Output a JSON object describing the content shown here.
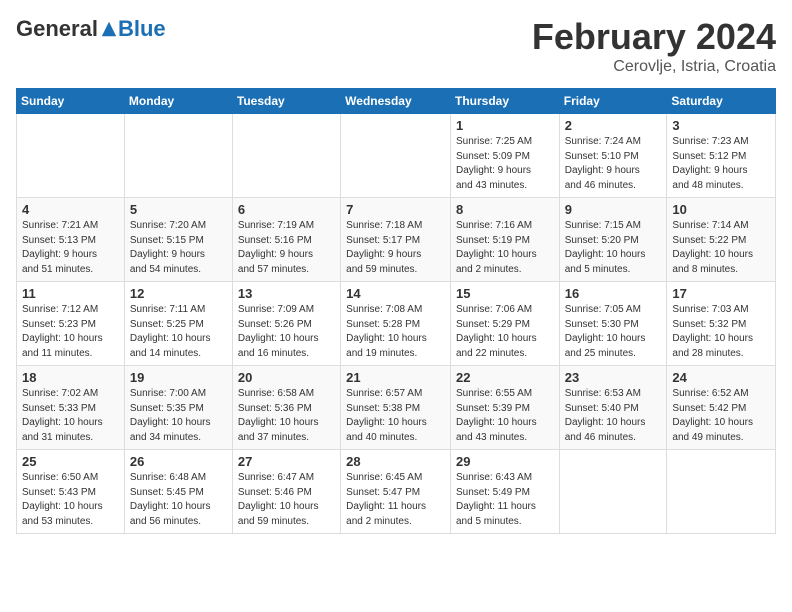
{
  "logo": {
    "general": "General",
    "blue": "Blue"
  },
  "header": {
    "month": "February 2024",
    "location": "Cerovlje, Istria, Croatia"
  },
  "days_of_week": [
    "Sunday",
    "Monday",
    "Tuesday",
    "Wednesday",
    "Thursday",
    "Friday",
    "Saturday"
  ],
  "weeks": [
    [
      {
        "day": "",
        "info": ""
      },
      {
        "day": "",
        "info": ""
      },
      {
        "day": "",
        "info": ""
      },
      {
        "day": "",
        "info": ""
      },
      {
        "day": "1",
        "info": "Sunrise: 7:25 AM\nSunset: 5:09 PM\nDaylight: 9 hours\nand 43 minutes."
      },
      {
        "day": "2",
        "info": "Sunrise: 7:24 AM\nSunset: 5:10 PM\nDaylight: 9 hours\nand 46 minutes."
      },
      {
        "day": "3",
        "info": "Sunrise: 7:23 AM\nSunset: 5:12 PM\nDaylight: 9 hours\nand 48 minutes."
      }
    ],
    [
      {
        "day": "4",
        "info": "Sunrise: 7:21 AM\nSunset: 5:13 PM\nDaylight: 9 hours\nand 51 minutes."
      },
      {
        "day": "5",
        "info": "Sunrise: 7:20 AM\nSunset: 5:15 PM\nDaylight: 9 hours\nand 54 minutes."
      },
      {
        "day": "6",
        "info": "Sunrise: 7:19 AM\nSunset: 5:16 PM\nDaylight: 9 hours\nand 57 minutes."
      },
      {
        "day": "7",
        "info": "Sunrise: 7:18 AM\nSunset: 5:17 PM\nDaylight: 9 hours\nand 59 minutes."
      },
      {
        "day": "8",
        "info": "Sunrise: 7:16 AM\nSunset: 5:19 PM\nDaylight: 10 hours\nand 2 minutes."
      },
      {
        "day": "9",
        "info": "Sunrise: 7:15 AM\nSunset: 5:20 PM\nDaylight: 10 hours\nand 5 minutes."
      },
      {
        "day": "10",
        "info": "Sunrise: 7:14 AM\nSunset: 5:22 PM\nDaylight: 10 hours\nand 8 minutes."
      }
    ],
    [
      {
        "day": "11",
        "info": "Sunrise: 7:12 AM\nSunset: 5:23 PM\nDaylight: 10 hours\nand 11 minutes."
      },
      {
        "day": "12",
        "info": "Sunrise: 7:11 AM\nSunset: 5:25 PM\nDaylight: 10 hours\nand 14 minutes."
      },
      {
        "day": "13",
        "info": "Sunrise: 7:09 AM\nSunset: 5:26 PM\nDaylight: 10 hours\nand 16 minutes."
      },
      {
        "day": "14",
        "info": "Sunrise: 7:08 AM\nSunset: 5:28 PM\nDaylight: 10 hours\nand 19 minutes."
      },
      {
        "day": "15",
        "info": "Sunrise: 7:06 AM\nSunset: 5:29 PM\nDaylight: 10 hours\nand 22 minutes."
      },
      {
        "day": "16",
        "info": "Sunrise: 7:05 AM\nSunset: 5:30 PM\nDaylight: 10 hours\nand 25 minutes."
      },
      {
        "day": "17",
        "info": "Sunrise: 7:03 AM\nSunset: 5:32 PM\nDaylight: 10 hours\nand 28 minutes."
      }
    ],
    [
      {
        "day": "18",
        "info": "Sunrise: 7:02 AM\nSunset: 5:33 PM\nDaylight: 10 hours\nand 31 minutes."
      },
      {
        "day": "19",
        "info": "Sunrise: 7:00 AM\nSunset: 5:35 PM\nDaylight: 10 hours\nand 34 minutes."
      },
      {
        "day": "20",
        "info": "Sunrise: 6:58 AM\nSunset: 5:36 PM\nDaylight: 10 hours\nand 37 minutes."
      },
      {
        "day": "21",
        "info": "Sunrise: 6:57 AM\nSunset: 5:38 PM\nDaylight: 10 hours\nand 40 minutes."
      },
      {
        "day": "22",
        "info": "Sunrise: 6:55 AM\nSunset: 5:39 PM\nDaylight: 10 hours\nand 43 minutes."
      },
      {
        "day": "23",
        "info": "Sunrise: 6:53 AM\nSunset: 5:40 PM\nDaylight: 10 hours\nand 46 minutes."
      },
      {
        "day": "24",
        "info": "Sunrise: 6:52 AM\nSunset: 5:42 PM\nDaylight: 10 hours\nand 49 minutes."
      }
    ],
    [
      {
        "day": "25",
        "info": "Sunrise: 6:50 AM\nSunset: 5:43 PM\nDaylight: 10 hours\nand 53 minutes."
      },
      {
        "day": "26",
        "info": "Sunrise: 6:48 AM\nSunset: 5:45 PM\nDaylight: 10 hours\nand 56 minutes."
      },
      {
        "day": "27",
        "info": "Sunrise: 6:47 AM\nSunset: 5:46 PM\nDaylight: 10 hours\nand 59 minutes."
      },
      {
        "day": "28",
        "info": "Sunrise: 6:45 AM\nSunset: 5:47 PM\nDaylight: 11 hours\nand 2 minutes."
      },
      {
        "day": "29",
        "info": "Sunrise: 6:43 AM\nSunset: 5:49 PM\nDaylight: 11 hours\nand 5 minutes."
      },
      {
        "day": "",
        "info": ""
      },
      {
        "day": "",
        "info": ""
      }
    ]
  ]
}
